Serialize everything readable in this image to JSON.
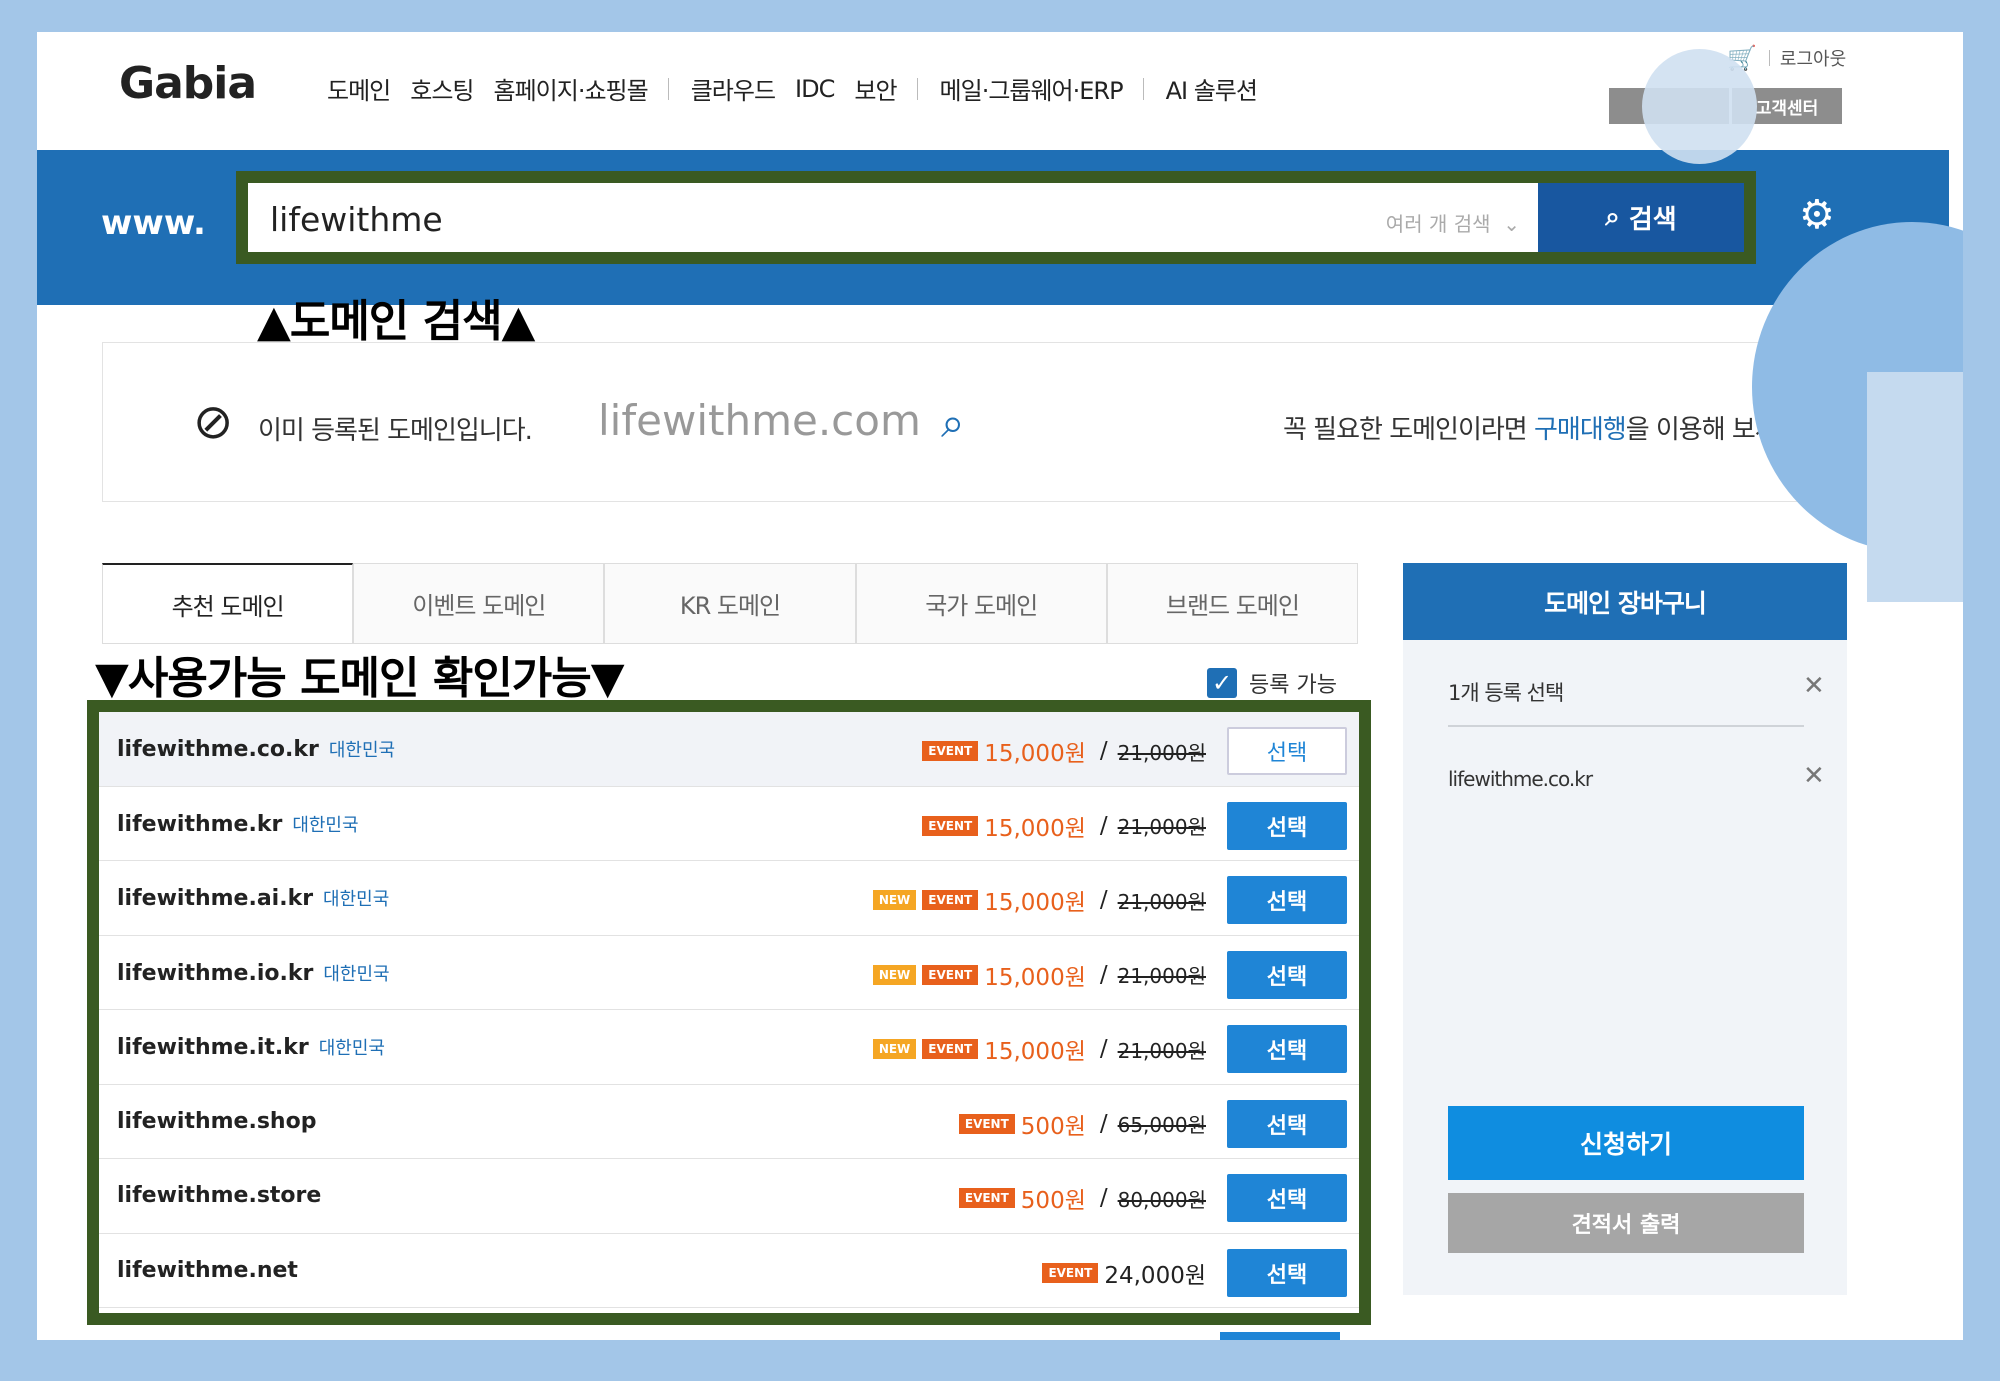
{
  "header": {
    "logo": "Gabia",
    "nav": [
      "도메인",
      "호스팅",
      "홈페이지·쇼핑몰",
      "클라우드",
      "IDC",
      "보안",
      "메일·그룹웨어·ERP",
      "AI 솔루션"
    ],
    "logout": "로그아웃",
    "support": "고객센터"
  },
  "search": {
    "prefix": "www.",
    "value": "lifewithme",
    "multi_label": "여러 개 검색",
    "button": "검색"
  },
  "annotations": {
    "search": "▲도메인 검색▲",
    "list": "▼사용가능 도메인 확인가능▼"
  },
  "notice": {
    "message": "이미 등록된 도메인입니다.",
    "domain": "lifewithme.com",
    "right_pre": "꼭 필요한 도메인이라면 ",
    "right_link": "구매대행",
    "right_post": "을 이용해 보세요."
  },
  "tabs": [
    "추천 도메인",
    "이벤트 도메인",
    "KR 도메인",
    "국가 도메인",
    "브랜드 도메인"
  ],
  "filter": {
    "available_label": "등록 가능",
    "checked": true
  },
  "domains": [
    {
      "name": "lifewithme.co.kr",
      "country": "대한민국",
      "new": false,
      "event": true,
      "price": "15,000원",
      "orig": "21,000원",
      "button": "선택",
      "selected": true
    },
    {
      "name": "lifewithme.kr",
      "country": "대한민국",
      "new": false,
      "event": true,
      "price": "15,000원",
      "orig": "21,000원",
      "button": "선택",
      "selected": false
    },
    {
      "name": "lifewithme.ai.kr",
      "country": "대한민국",
      "new": true,
      "event": true,
      "price": "15,000원",
      "orig": "21,000원",
      "button": "선택",
      "selected": false
    },
    {
      "name": "lifewithme.io.kr",
      "country": "대한민국",
      "new": true,
      "event": true,
      "price": "15,000원",
      "orig": "21,000원",
      "button": "선택",
      "selected": false
    },
    {
      "name": "lifewithme.it.kr",
      "country": "대한민국",
      "new": true,
      "event": true,
      "price": "15,000원",
      "orig": "21,000원",
      "button": "선택",
      "selected": false
    },
    {
      "name": "lifewithme.shop",
      "country": "",
      "new": false,
      "event": true,
      "price": "500원",
      "orig": "65,000원",
      "button": "선택",
      "selected": false
    },
    {
      "name": "lifewithme.store",
      "country": "",
      "new": false,
      "event": true,
      "price": "500원",
      "orig": "80,000원",
      "button": "선택",
      "selected": false
    },
    {
      "name": "lifewithme.net",
      "country": "",
      "new": false,
      "event": true,
      "price": "24,000원",
      "orig": "",
      "button": "선택",
      "selected": false
    }
  ],
  "badges": {
    "new": "NEW",
    "event": "EVENT"
  },
  "cart": {
    "title": "도메인 장바구니",
    "count_label": "1개 등록 선택",
    "items": [
      "lifewithme.co.kr"
    ],
    "apply": "신청하기",
    "quote": "견적서 출력"
  },
  "colors": {
    "brand_blue": "#1f6fb5",
    "button_blue": "#1f85d6",
    "event_orange": "#e8601c",
    "new_yellow": "#f5a623",
    "annotation_green": "#3a5a22",
    "page_bg": "#a3c6e8"
  }
}
